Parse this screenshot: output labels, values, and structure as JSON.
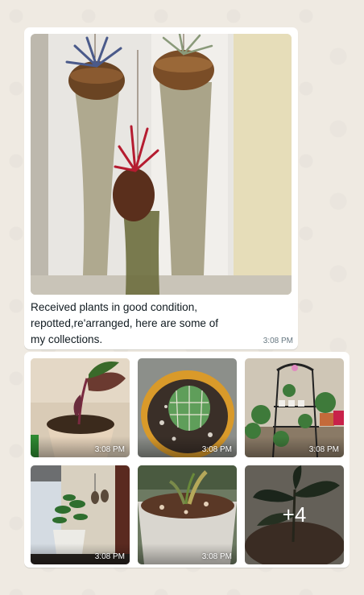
{
  "message1": {
    "caption": "Received plants in good condition, repotted,re'arranged, here are some of my collections.",
    "time": "3:08 PM",
    "photo": "hanging-air-plants-photo"
  },
  "message2": {
    "tiles": [
      {
        "name": "zz-plant-cutting-photo",
        "time": "3:08 PM"
      },
      {
        "name": "cactus-pot-photo",
        "time": "3:08 PM"
      },
      {
        "name": "plant-stand-photo",
        "time": "3:08 PM"
      },
      {
        "name": "zz-plant-window-photo",
        "time": "3:08 PM"
      },
      {
        "name": "seedling-pot-photo",
        "time": "3:08 PM"
      },
      {
        "name": "rubber-plant-photo",
        "more": "+4"
      }
    ]
  }
}
